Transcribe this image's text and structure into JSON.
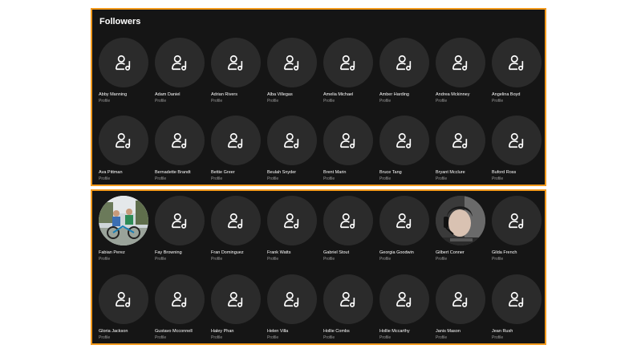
{
  "section_title": "Followers",
  "top_rows": [
    [
      {
        "name": "Abby Manning",
        "sub": "Profile",
        "avatar": "user-music-icon"
      },
      {
        "name": "Adam Daniel",
        "sub": "Profile",
        "avatar": "user-music-icon"
      },
      {
        "name": "Adrian Rivers",
        "sub": "Profile",
        "avatar": "user-music-icon"
      },
      {
        "name": "Alba Villegas",
        "sub": "Profile",
        "avatar": "user-music-icon"
      },
      {
        "name": "Amelia Michael",
        "sub": "Profile",
        "avatar": "user-music-icon"
      },
      {
        "name": "Amber Harding",
        "sub": "Profile",
        "avatar": "user-music-icon"
      },
      {
        "name": "Andrea Mckinney",
        "sub": "Profile",
        "avatar": "user-music-icon"
      },
      {
        "name": "Angelina Boyd",
        "sub": "Profile",
        "avatar": "user-music-icon"
      }
    ],
    [
      {
        "name": "Ava Pittman",
        "sub": "Profile",
        "avatar": "user-music-icon"
      },
      {
        "name": "Bernadette Brandt",
        "sub": "Profile",
        "avatar": "user-music-icon"
      },
      {
        "name": "Bettie Greer",
        "sub": "Profile",
        "avatar": "user-music-icon"
      },
      {
        "name": "Beulah Snyder",
        "sub": "Profile",
        "avatar": "user-music-icon"
      },
      {
        "name": "Brent Marin",
        "sub": "Profile",
        "avatar": "user-music-icon"
      },
      {
        "name": "Bruce Tang",
        "sub": "Profile",
        "avatar": "user-music-icon"
      },
      {
        "name": "Bryant Mcclure",
        "sub": "Profile",
        "avatar": "user-music-icon"
      },
      {
        "name": "Buford Ross",
        "sub": "Profile",
        "avatar": "user-music-icon"
      }
    ]
  ],
  "bottom_rows": [
    [
      {
        "name": "Fabian Perez",
        "sub": "Profile",
        "avatar": "photo-kids-bikes"
      },
      {
        "name": "Fay Browning",
        "sub": "Profile",
        "avatar": "user-music-icon"
      },
      {
        "name": "Fran Dominguez",
        "sub": "Profile",
        "avatar": "user-music-icon"
      },
      {
        "name": "Frank Watts",
        "sub": "Profile",
        "avatar": "user-music-icon"
      },
      {
        "name": "Gabriel Stout",
        "sub": "Profile",
        "avatar": "user-music-icon"
      },
      {
        "name": "Georgia Goodwin",
        "sub": "Profile",
        "avatar": "user-music-icon"
      },
      {
        "name": "Gilbert Conner",
        "sub": "Profile",
        "avatar": "photo-headset-person"
      },
      {
        "name": "Gilda French",
        "sub": "Profile",
        "avatar": "user-music-icon"
      }
    ],
    [
      {
        "name": "Gloria Jackson",
        "sub": "Profile",
        "avatar": "user-music-icon"
      },
      {
        "name": "Gustavo Mcconnell",
        "sub": "Profile",
        "avatar": "user-music-icon"
      },
      {
        "name": "Haley Phan",
        "sub": "Profile",
        "avatar": "user-music-icon"
      },
      {
        "name": "Helen Villa",
        "sub": "Profile",
        "avatar": "user-music-icon"
      },
      {
        "name": "Hollie Combs",
        "sub": "Profile",
        "avatar": "user-music-icon"
      },
      {
        "name": "Hollie Mccarthy",
        "sub": "Profile",
        "avatar": "user-music-icon"
      },
      {
        "name": "Janis Mason",
        "sub": "Profile",
        "avatar": "user-music-icon"
      },
      {
        "name": "Jean Rush",
        "sub": "Profile",
        "avatar": "user-music-icon"
      }
    ]
  ],
  "colors": {
    "panel_bg": "#151515",
    "border": "#f39a1c",
    "avatar_bg": "#2b2b2b",
    "text": "#ffffff",
    "subtext": "#9a9a9a"
  }
}
